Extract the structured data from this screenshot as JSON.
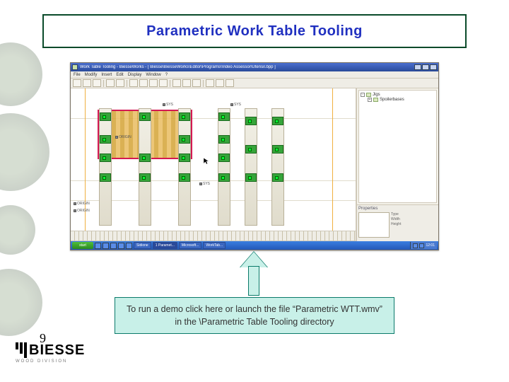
{
  "slide": {
    "title": "Parametric Work Table Tooling",
    "page_number": "9",
    "caption": "To run a demo click here or launch the file “Parametric WTT.wmv” in the \\Parametric Table Tooling directory"
  },
  "logo": {
    "brand": "BIESSE",
    "sub": "WOOD DIVISION"
  },
  "app": {
    "title": "Work Table Tooling - BiesseWorks - [ Biesse\\BiesseWorks\\Editor\\Programs\\Video Assessor\\Utensil.bpp ]",
    "menus": [
      "File",
      "Modify",
      "Insert",
      "Edit",
      "Display",
      "Window",
      "?"
    ],
    "tree": {
      "root": "Jigs",
      "child": "Spoilerbases"
    },
    "props": {
      "title": "Properties",
      "fields": [
        "Type",
        "Width",
        "Height"
      ]
    },
    "canvas_labels": {
      "origin": "ORIGIN",
      "sys": "SYS"
    },
    "taskbar": {
      "start": "start",
      "items": [
        "Sidione",
        "1 Paramet...",
        "Microsoft...",
        "WorkTab..."
      ],
      "time": "12:01"
    }
  }
}
